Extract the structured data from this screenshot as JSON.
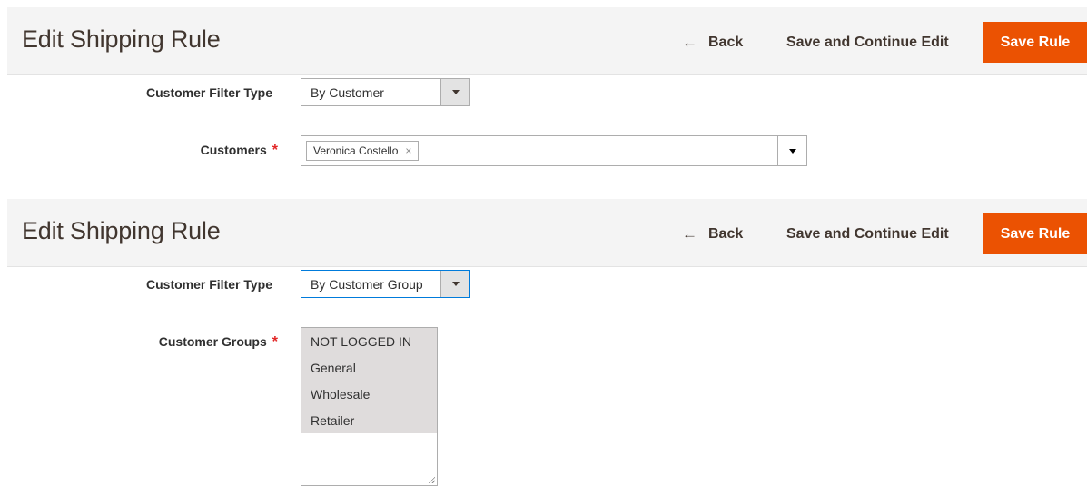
{
  "panel1": {
    "title": "Edit Shipping Rule",
    "back_label": "Back",
    "continue_label": "Save and Continue Edit",
    "save_label": "Save Rule",
    "filter_type_label": "Customer Filter Type",
    "filter_type_value": "By Customer",
    "customers_label": "Customers",
    "required_mark": "*",
    "selected_customer": "Veronica Costello",
    "chip_remove": "×"
  },
  "panel2": {
    "title": "Edit Shipping Rule",
    "back_label": "Back",
    "continue_label": "Save and Continue Edit",
    "save_label": "Save Rule",
    "filter_type_label": "Customer Filter Type",
    "filter_type_value": "By Customer Group",
    "groups_label": "Customer Groups",
    "required_mark": "*",
    "groups": [
      "NOT LOGGED IN",
      "General",
      "Wholesale",
      "Retailer"
    ]
  },
  "icons": {
    "back": "arrow-left-icon",
    "dropdown": "chevron-down-icon",
    "remove": "close-icon"
  },
  "colors": {
    "accent": "#eb5202",
    "required": "#e22626",
    "focus": "#007bdb",
    "header_bg": "#f4f4f4",
    "selected_option_bg": "#dfdcdc"
  }
}
